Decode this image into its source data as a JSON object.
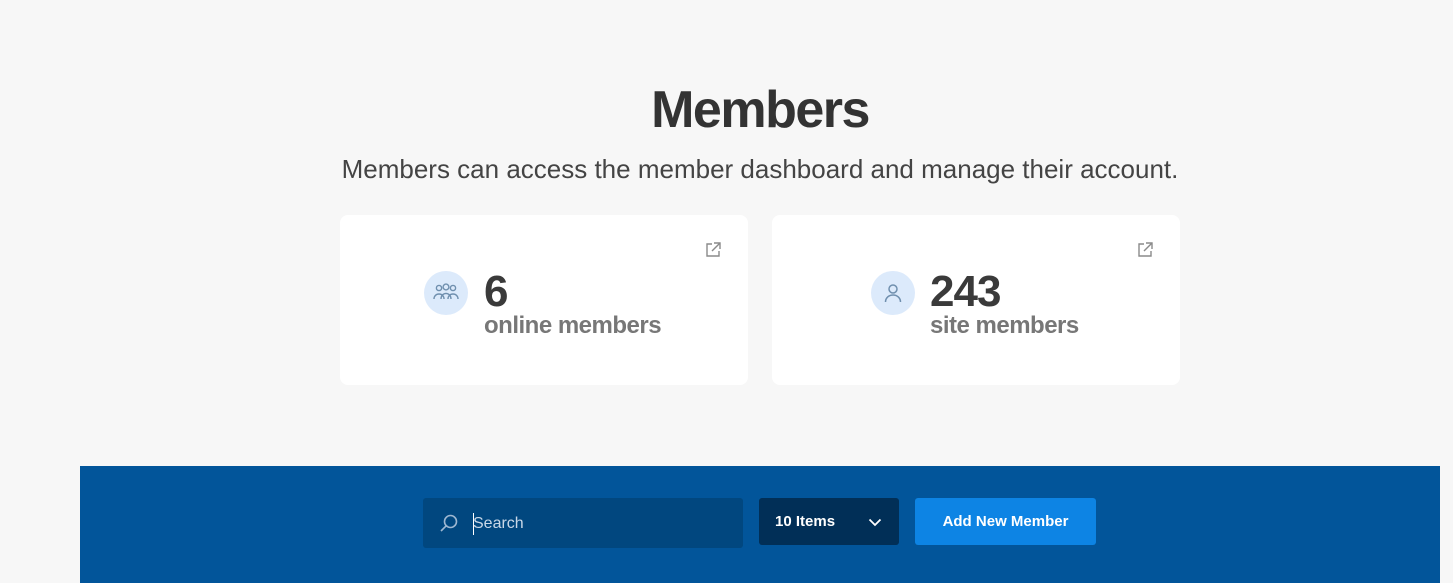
{
  "header": {
    "title": "Members",
    "subtitle": "Members can access the member dashboard and manage their account."
  },
  "stats": [
    {
      "value": "6",
      "label": "online members",
      "icon": "group-icon"
    },
    {
      "value": "243",
      "label": "site members",
      "icon": "user-icon"
    }
  ],
  "toolbar": {
    "search": {
      "placeholder": "Search",
      "value": ""
    },
    "items_select": {
      "selected": "10 Items"
    },
    "add_button_label": "Add New Member"
  },
  "colors": {
    "toolbar_bg": "#02559a",
    "search_bg": "#01477f",
    "select_bg": "#012f57",
    "button_bg": "#0d84e4",
    "avatar_bg": "#dceafb"
  }
}
